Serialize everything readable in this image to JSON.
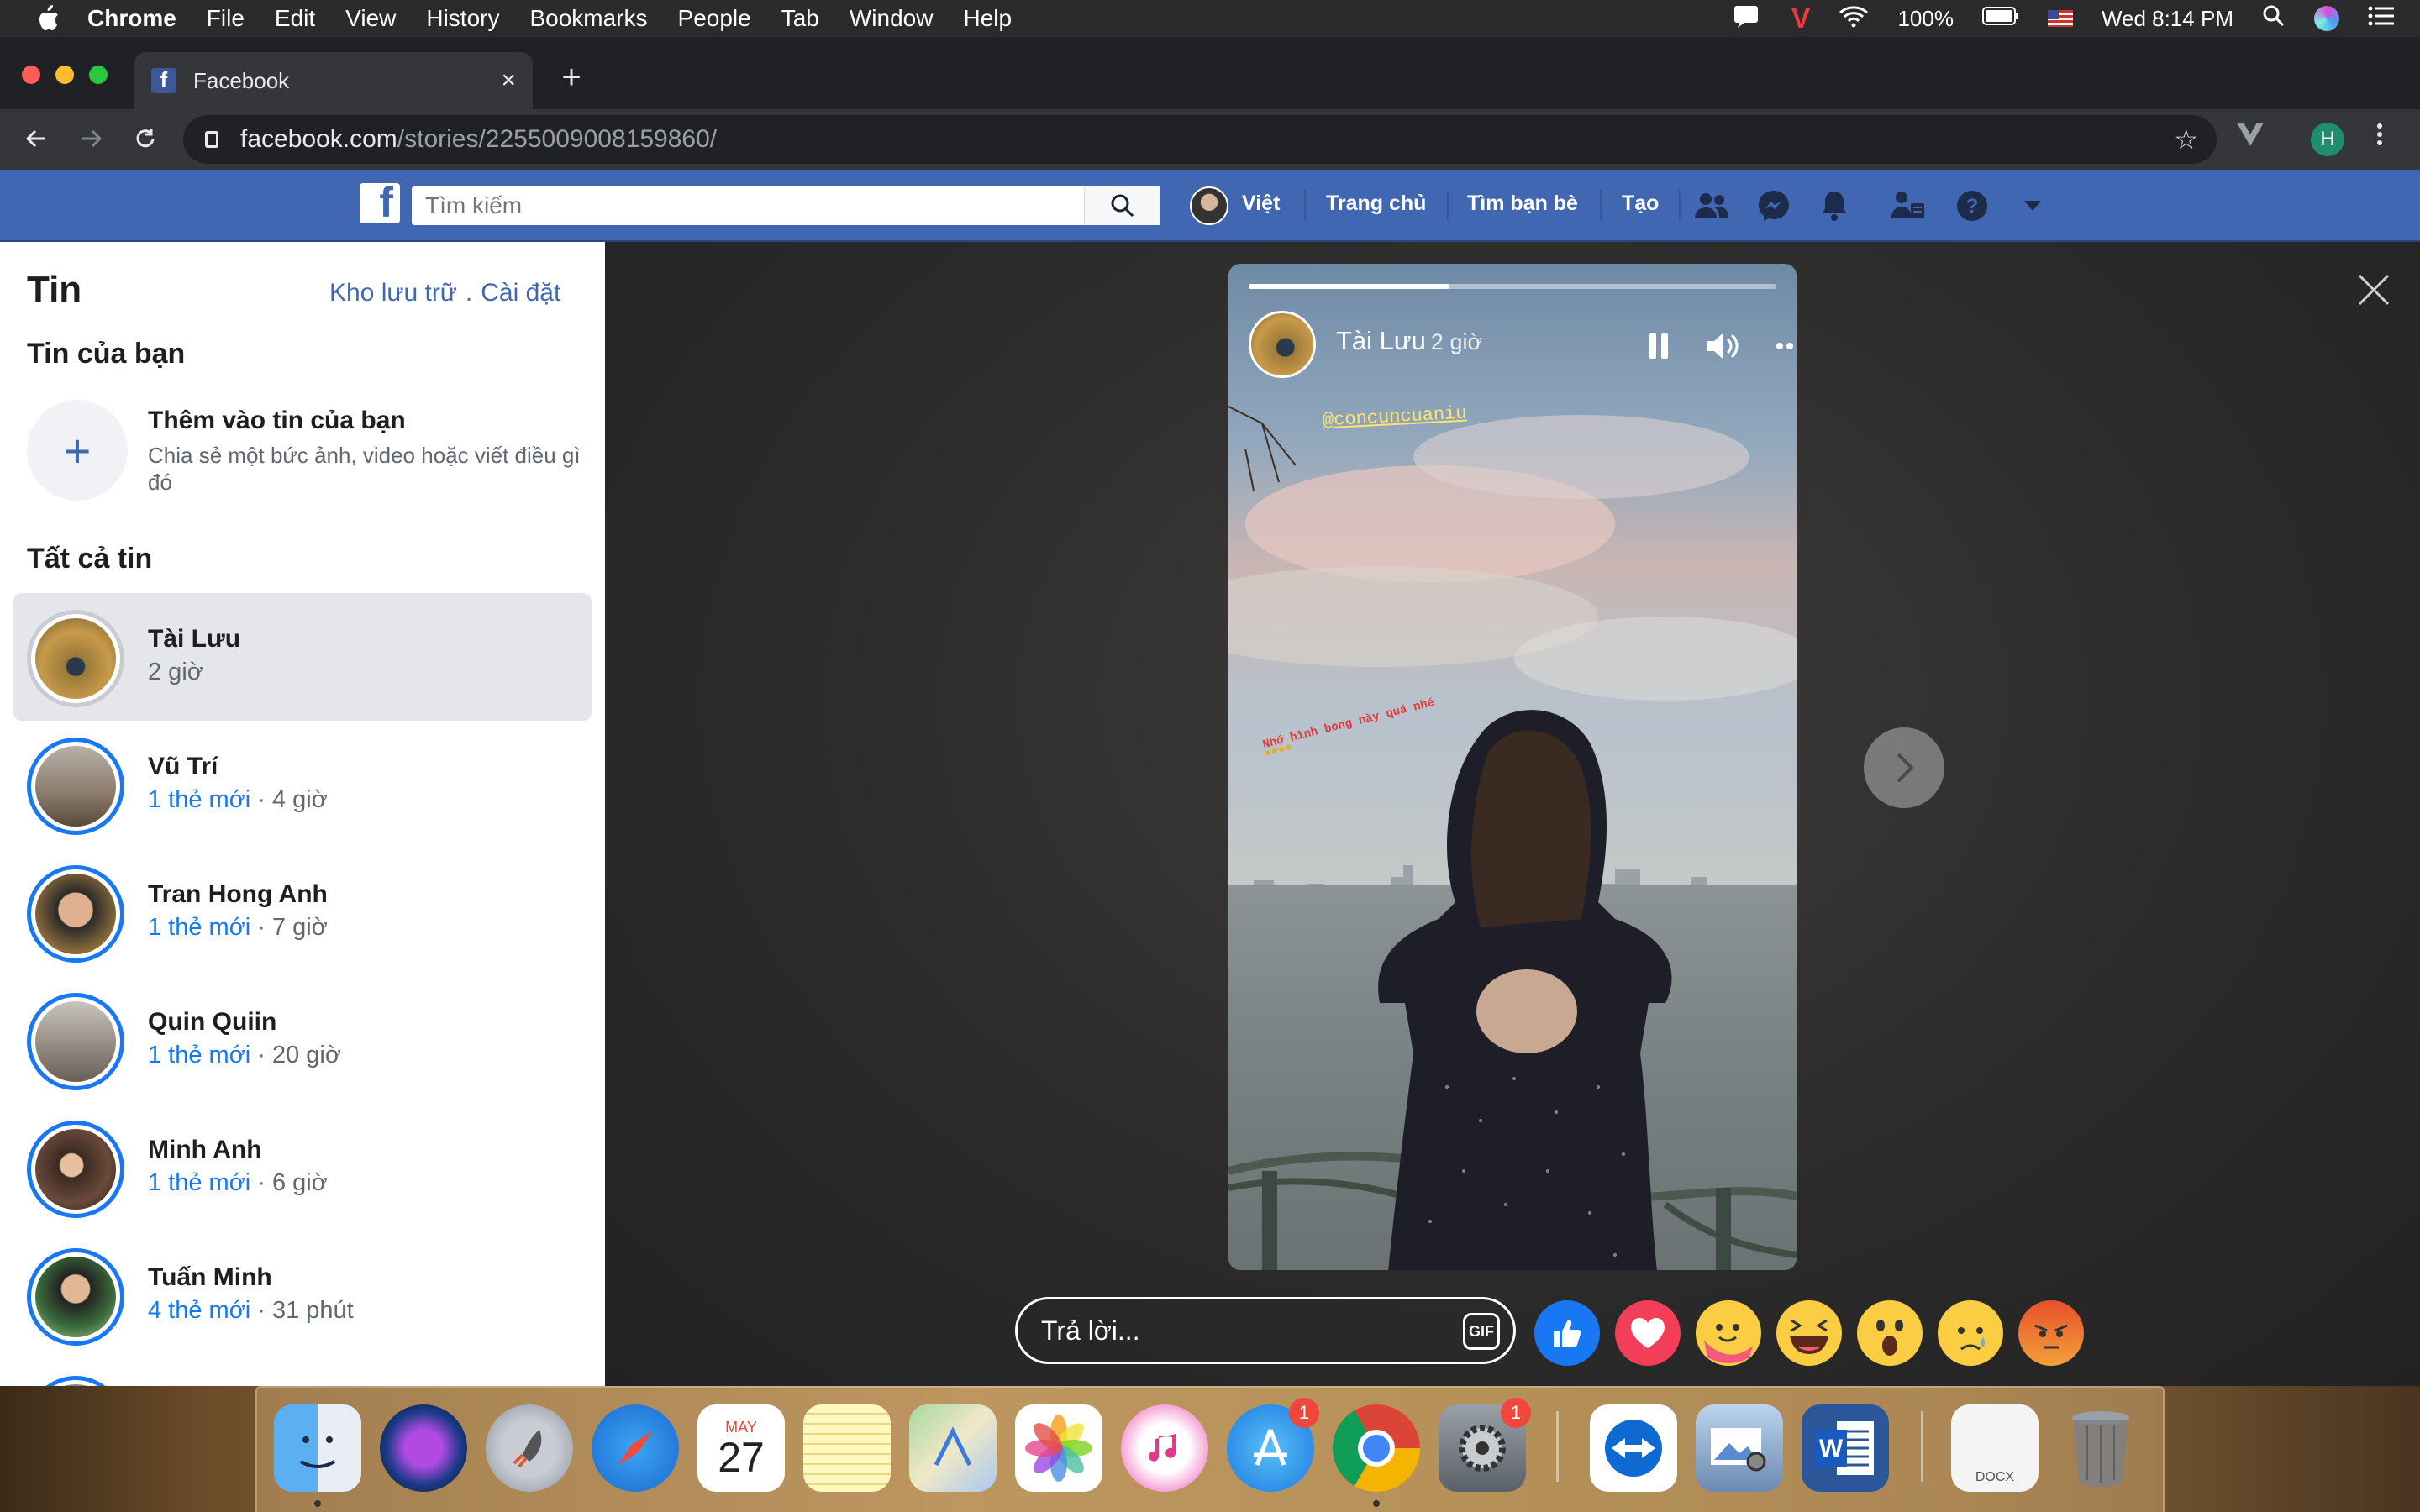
{
  "menubar": {
    "apple": "",
    "app": "Chrome",
    "items": [
      "File",
      "Edit",
      "View",
      "History",
      "Bookmarks",
      "People",
      "Tab",
      "Window",
      "Help"
    ],
    "battery": "100%",
    "clock": "Wed 8:14 PM"
  },
  "browser": {
    "tab_title": "Facebook",
    "new_tab": "+",
    "close_tab": "×",
    "url_domain": "facebook.com",
    "url_path": "/stories/2255009008159860/",
    "profile_initial": "H"
  },
  "fb_header": {
    "logo": "f",
    "search_placeholder": "Tìm kiếm",
    "user_name": "Việt",
    "nav": [
      "Trang chủ",
      "Tìm bạn bè",
      "Tạo"
    ]
  },
  "sidebar": {
    "title": "Tin",
    "link_archive": "Kho lưu trữ",
    "link_dot": ".",
    "link_settings": "Cài đặt",
    "your_stories": "Tin của bạn",
    "add_title": "Thêm vào tin của bạn",
    "add_subtitle": "Chia sẻ một bức ảnh, video hoặc viết điều gì đó",
    "add_plus": "+",
    "all_stories": "Tất cả tin",
    "stories": [
      {
        "name": "Tài Lưu",
        "new": "",
        "time": "2 giờ",
        "active": true
      },
      {
        "name": "Vũ Trí",
        "new": "1 thẻ mới",
        "time": " · 4 giờ"
      },
      {
        "name": "Tran Hong Anh",
        "new": "1 thẻ mới",
        "time": " · 7 giờ"
      },
      {
        "name": "Quin Quiin",
        "new": "1 thẻ mới",
        "time": " · 20 giờ"
      },
      {
        "name": "Minh Anh",
        "new": "1 thẻ mới",
        "time": " · 6 giờ"
      },
      {
        "name": "Tuấn Minh",
        "new": "4 thẻ mới",
        "time": " · 31 phút"
      }
    ]
  },
  "viewer": {
    "user": "Tài Lưu",
    "time": "2 giờ",
    "progress": 0.38,
    "mention": "@concuncuaniu",
    "caption": "Nhớ hình bóng này quá nhé",
    "reply_placeholder": "Trả lời...",
    "gif_label": "GIF",
    "reactions": [
      "like-reaction",
      "love-reaction",
      "care-reaction",
      "haha-reaction",
      "wow-reaction",
      "sad-reaction",
      "angry-reaction"
    ]
  },
  "dock": {
    "calendar_month": "MAY",
    "calendar_day": "27",
    "appstore_badge": "1",
    "prefs_badge": "1",
    "docx_label": "DOCX"
  },
  "colors": {
    "fb_blue": "#4267b2",
    "link_blue": "#1877f2",
    "menubar": "#2b2b2d"
  }
}
